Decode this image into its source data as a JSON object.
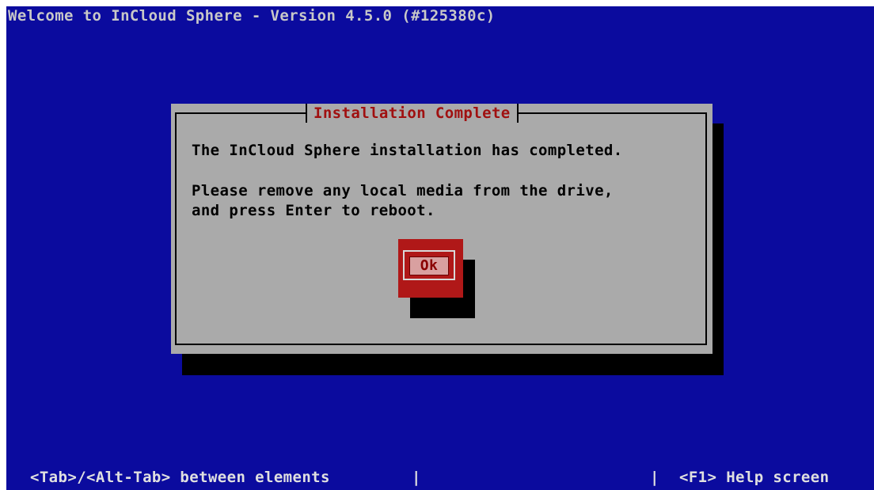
{
  "header": {
    "title": "Welcome to InCloud Sphere - Version 4.5.0 (#125380c)"
  },
  "dialog": {
    "title": "Installation Complete",
    "message_line1": "The InCloud Sphere installation has completed.",
    "message_line2": "Please remove any local media from the drive,",
    "message_line3": "and press Enter to reboot.",
    "ok_label": "Ok"
  },
  "help_bar": {
    "left": "<Tab>/<Alt-Tab> between elements",
    "separator": "|",
    "right": "<F1> Help screen"
  },
  "colors": {
    "background": "#0b0b9e",
    "dialog": "#aaaaaa",
    "title_text": "#a01010",
    "button": "#b01818"
  }
}
